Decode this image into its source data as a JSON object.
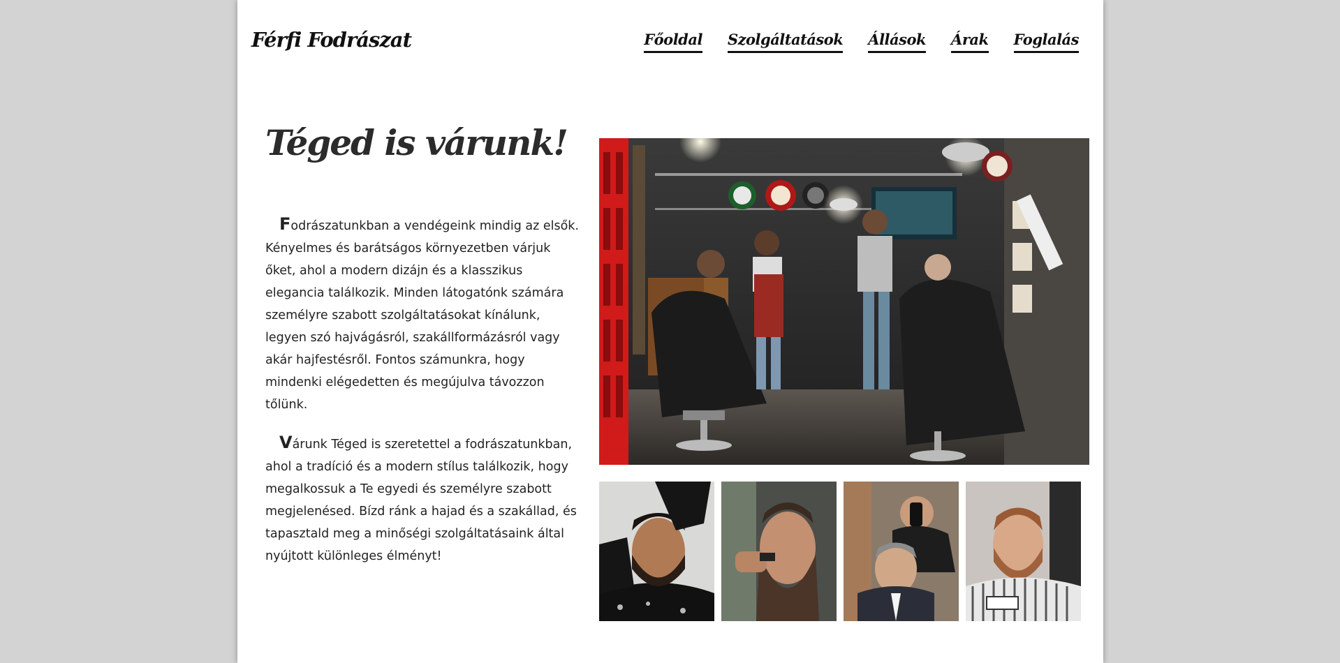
{
  "header": {
    "logo": "Férfi Fodrászat",
    "nav": [
      "Főoldal",
      "Szolgáltatások",
      "Állások",
      "Árak",
      "Foglalás"
    ]
  },
  "main": {
    "headline": "Téged is várunk!",
    "paragraphs": [
      {
        "first_letter": "F",
        "rest": "odrászatunkban a vendégeink mindig az elsők. Kényelmes és barátságos környezetben várjuk őket, ahol a modern dizájn és a klasszikus elegancia találkozik. Minden látogatónk számára személyre szabott szolgáltatásokat kínálunk, legyen szó hajvágásról, szakállformázásról vagy akár hajfestésről. Fontos számunkra, hogy mindenki elégedetten és megújulva távozzon tőlünk."
      },
      {
        "first_letter": "V",
        "rest": "árunk Téged is szeretettel a fodrászatunkban, ahol a tradíció és a modern stílus találkozik, hogy megalkossuk a Te egyedi és személyre szabott megjelenésed. Bízd ránk a hajad és a szakállad, és tapasztald meg a minőségi szolgáltatásaink által nyújtott különleges élményt!"
      }
    ]
  },
  "colors": {
    "background": "#d3d3d3",
    "page": "#ffffff",
    "text": "#222222"
  }
}
